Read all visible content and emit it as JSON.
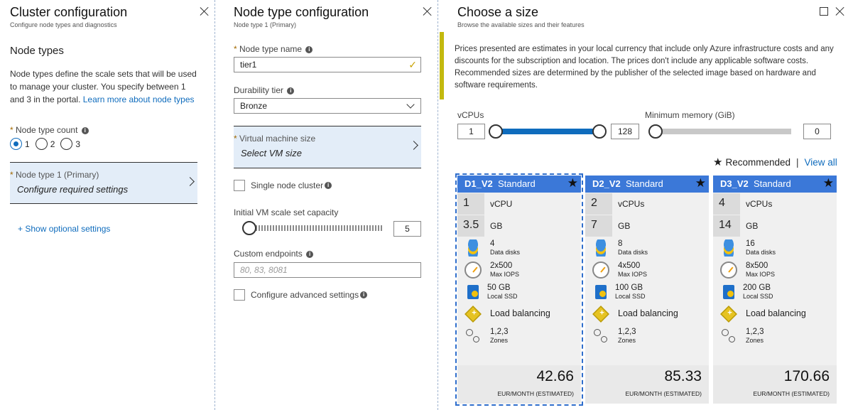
{
  "blade1": {
    "title": "Cluster configuration",
    "subtitle": "Configure node types and diagnostics",
    "heading": "Node types",
    "description_text": "Node types define the scale sets that will be used to manage your cluster. You specify between 1 and 3 in the portal.",
    "learn_more_link": "Learn more about node types",
    "node_type_count_label": "Node type count",
    "radio_options": [
      "1",
      "2",
      "3"
    ],
    "selected_count": "1",
    "node_type_tile_label": "Node type 1 (Primary)",
    "node_type_tile_value": "Configure required settings",
    "show_optional": "+ Show optional settings"
  },
  "blade2": {
    "title": "Node type configuration",
    "subtitle": "Node type 1 (Primary)",
    "name_label": "Node type name",
    "name_value": "tier1",
    "durability_label": "Durability tier",
    "durability_value": "Bronze",
    "vm_size_label": "Virtual machine size",
    "vm_size_value": "Select VM size",
    "single_node_label": "Single node cluster",
    "capacity_label": "Initial VM scale set capacity",
    "capacity_value": "5",
    "endpoints_label": "Custom endpoints",
    "endpoints_placeholder": "80, 83, 8081",
    "advanced_label": "Configure advanced settings"
  },
  "blade3": {
    "title": "Choose a size",
    "subtitle": "Browse the available sizes and their features",
    "notice": "Prices presented are estimates in your local currency that include only Azure infrastructure costs and any discounts for the subscription and location. The prices don't include any applicable software costs. Recommended sizes are determined by the publisher of the selected image based on hardware and software requirements.",
    "vcpus_label": "vCPUs",
    "vcpus_min": "1",
    "vcpus_max": "128",
    "memory_label": "Minimum memory (GiB)",
    "memory_value": "0",
    "recommended_label": "Recommended",
    "view_all": "View all",
    "cards": [
      {
        "name": "D1_V2",
        "tier": "Standard",
        "vcpu_num": "1",
        "vcpu_unit": "vCPU",
        "mem_num": "3.5",
        "mem_unit": "GB",
        "disks": "4",
        "disks_label": "Data disks",
        "iops": "2x500",
        "iops_label": "Max IOPS",
        "ssd": "50 GB",
        "ssd_label": "Local SSD",
        "lb": "Load balancing",
        "zones": "1,2,3",
        "zones_label": "Zones",
        "price": "42.66",
        "price_label": "EUR/MONTH (ESTIMATED)"
      },
      {
        "name": "D2_V2",
        "tier": "Standard",
        "vcpu_num": "2",
        "vcpu_unit": "vCPUs",
        "mem_num": "7",
        "mem_unit": "GB",
        "disks": "8",
        "disks_label": "Data disks",
        "iops": "4x500",
        "iops_label": "Max IOPS",
        "ssd": "100 GB",
        "ssd_label": "Local SSD",
        "lb": "Load balancing",
        "zones": "1,2,3",
        "zones_label": "Zones",
        "price": "85.33",
        "price_label": "EUR/MONTH (ESTIMATED)"
      },
      {
        "name": "D3_V2",
        "tier": "Standard",
        "vcpu_num": "4",
        "vcpu_unit": "vCPUs",
        "mem_num": "14",
        "mem_unit": "GB",
        "disks": "16",
        "disks_label": "Data disks",
        "iops": "8x500",
        "iops_label": "Max IOPS",
        "ssd": "200 GB",
        "ssd_label": "Local SSD",
        "lb": "Load balancing",
        "zones": "1,2,3",
        "zones_label": "Zones",
        "price": "170.66",
        "price_label": "EUR/MONTH (ESTIMATED)"
      }
    ]
  },
  "colors": {
    "accent": "#0f6cbd",
    "card_header": "#3b78d8",
    "tile_bg": "#e3edf8",
    "notice_bar": "#c3b90f"
  }
}
